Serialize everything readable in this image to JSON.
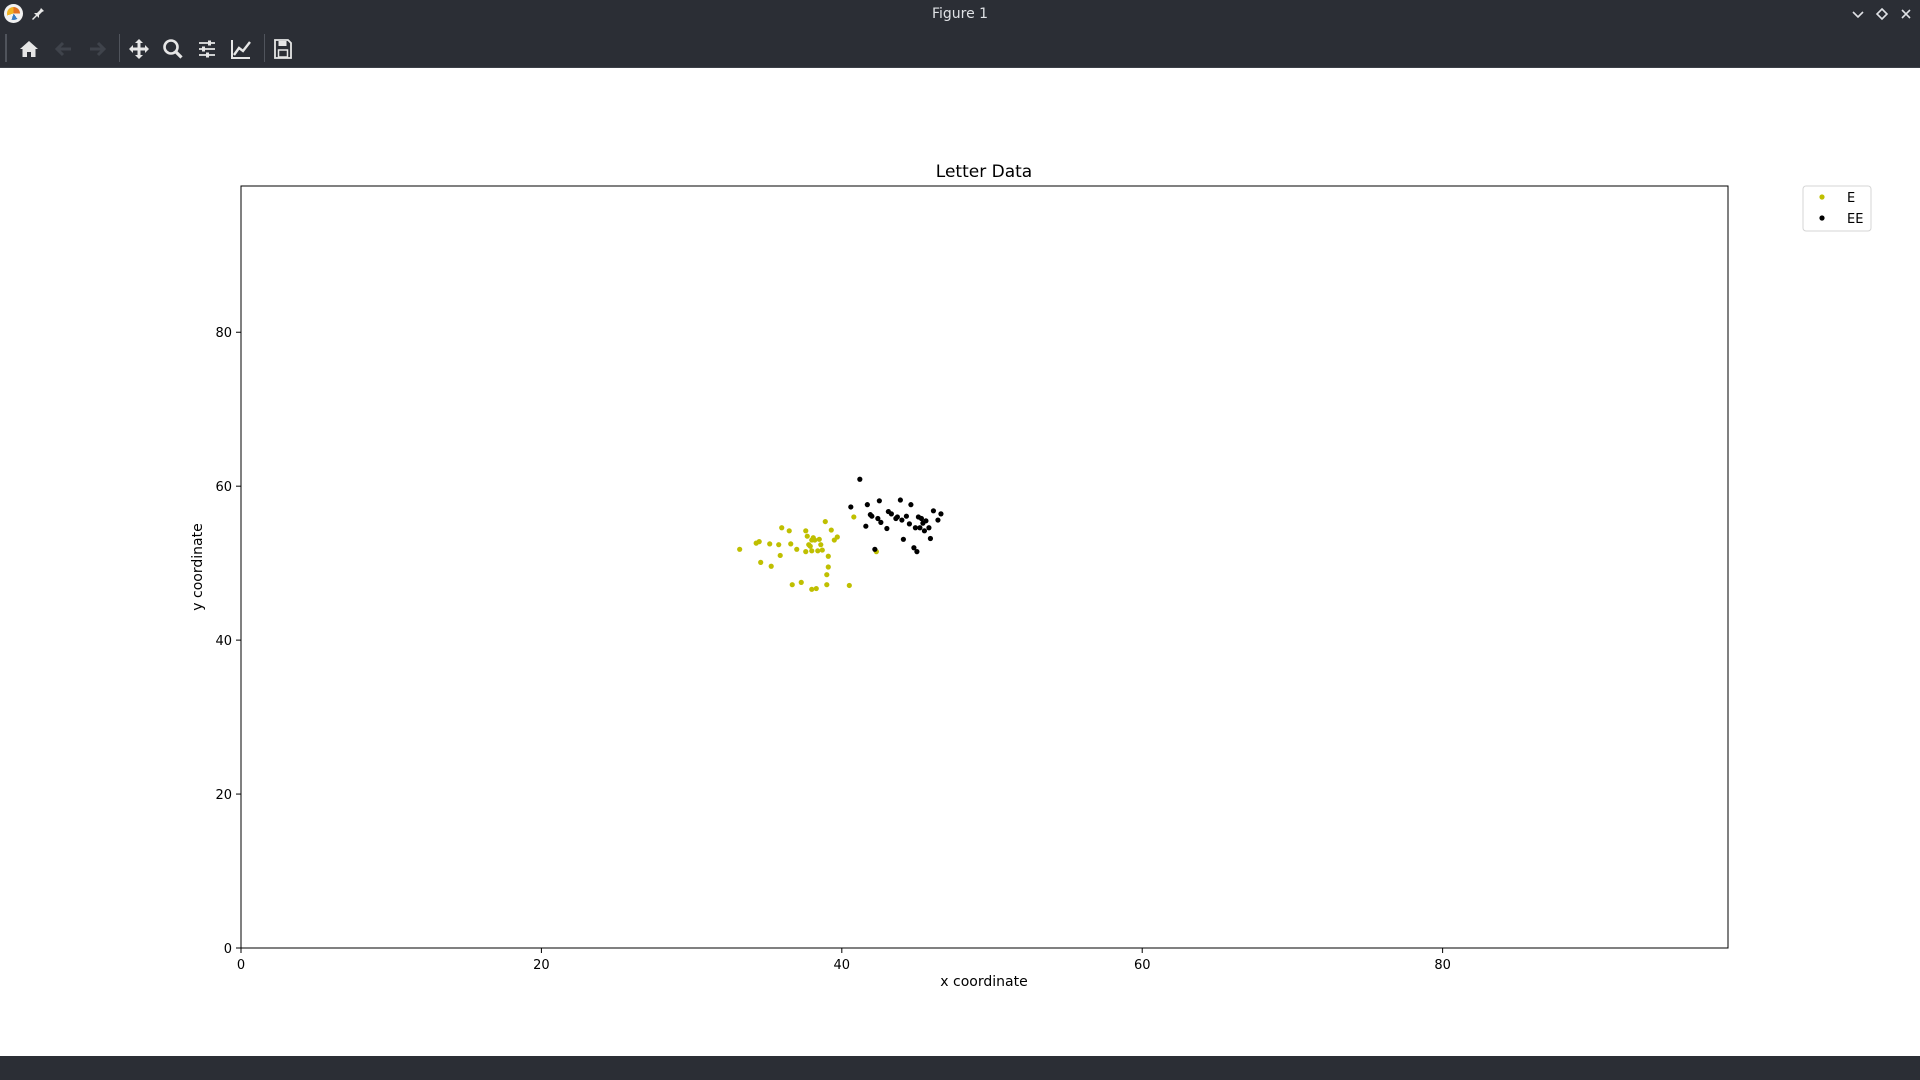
{
  "window": {
    "title": "Figure 1"
  },
  "toolbar": {
    "buttons": [
      {
        "name": "home",
        "icon": "home-icon",
        "enabled": true
      },
      {
        "name": "back",
        "icon": "arrow-left-icon",
        "enabled": false
      },
      {
        "name": "forward",
        "icon": "arrow-right-icon",
        "enabled": false
      },
      {
        "name": "pan",
        "icon": "move-icon",
        "enabled": true
      },
      {
        "name": "zoom",
        "icon": "magnifier-icon",
        "enabled": true
      },
      {
        "name": "subplots",
        "icon": "sliders-icon",
        "enabled": true
      },
      {
        "name": "customize",
        "icon": "chart-line-icon",
        "enabled": true
      },
      {
        "name": "save",
        "icon": "floppy-icon",
        "enabled": true
      }
    ]
  },
  "colors": {
    "chrome": "#2b2e35",
    "series_E": "#bfbf00",
    "series_EE": "#000000"
  },
  "chart_data": {
    "type": "scatter",
    "title": "Letter Data",
    "xlabel": "x coordinate",
    "ylabel": "y coordinate",
    "xlim": [
      0,
      99
    ],
    "ylim": [
      0,
      99
    ],
    "xticks": [
      0,
      20,
      40,
      60,
      80
    ],
    "yticks": [
      0,
      20,
      40,
      60,
      80
    ],
    "grid": false,
    "legend": "top-right-outside",
    "series": [
      {
        "name": "E",
        "color": "#bfbf00",
        "points": [
          [
            33.2,
            51.8
          ],
          [
            34.3,
            52.6
          ],
          [
            34.5,
            52.8
          ],
          [
            34.6,
            50.1
          ],
          [
            35.2,
            52.5
          ],
          [
            35.3,
            49.6
          ],
          [
            35.8,
            52.4
          ],
          [
            35.9,
            51.0
          ],
          [
            36.0,
            54.6
          ],
          [
            36.5,
            54.2
          ],
          [
            36.6,
            52.5
          ],
          [
            36.7,
            47.2
          ],
          [
            37.0,
            51.8
          ],
          [
            37.3,
            47.5
          ],
          [
            37.6,
            51.5
          ],
          [
            37.6,
            54.2
          ],
          [
            37.7,
            53.5
          ],
          [
            37.8,
            52.4
          ],
          [
            37.9,
            52.2
          ],
          [
            38.0,
            46.6
          ],
          [
            38.0,
            51.6
          ],
          [
            38.0,
            53.0
          ],
          [
            38.1,
            53.3
          ],
          [
            38.2,
            53.0
          ],
          [
            38.3,
            46.7
          ],
          [
            38.4,
            51.6
          ],
          [
            38.5,
            53.1
          ],
          [
            38.6,
            52.4
          ],
          [
            38.7,
            51.7
          ],
          [
            38.9,
            55.4
          ],
          [
            39.0,
            47.2
          ],
          [
            39.0,
            48.5
          ],
          [
            39.1,
            49.5
          ],
          [
            39.1,
            50.9
          ],
          [
            39.3,
            54.3
          ],
          [
            39.5,
            53.0
          ],
          [
            39.7,
            53.4
          ],
          [
            40.5,
            47.1
          ],
          [
            40.8,
            56.0
          ],
          [
            42.3,
            51.5
          ]
        ]
      },
      {
        "name": "EE",
        "color": "#000000",
        "points": [
          [
            40.6,
            57.3
          ],
          [
            41.2,
            60.9
          ],
          [
            41.6,
            54.8
          ],
          [
            41.7,
            57.6
          ],
          [
            41.9,
            56.3
          ],
          [
            42.0,
            56.1
          ],
          [
            42.2,
            51.8
          ],
          [
            42.4,
            55.8
          ],
          [
            42.5,
            58.1
          ],
          [
            42.6,
            55.3
          ],
          [
            43.0,
            54.5
          ],
          [
            43.1,
            56.7
          ],
          [
            43.3,
            56.4
          ],
          [
            43.6,
            55.8
          ],
          [
            43.7,
            56.0
          ],
          [
            43.9,
            58.2
          ],
          [
            44.0,
            55.6
          ],
          [
            44.1,
            53.1
          ],
          [
            44.3,
            56.1
          ],
          [
            44.5,
            55.1
          ],
          [
            44.6,
            57.6
          ],
          [
            44.8,
            52.0
          ],
          [
            44.9,
            54.6
          ],
          [
            45.0,
            51.5
          ],
          [
            45.1,
            56.0
          ],
          [
            45.2,
            54.6
          ],
          [
            45.3,
            55.8
          ],
          [
            45.4,
            55.2
          ],
          [
            45.5,
            54.2
          ],
          [
            45.6,
            55.5
          ],
          [
            45.8,
            54.6
          ],
          [
            45.9,
            53.2
          ],
          [
            46.1,
            56.8
          ],
          [
            46.4,
            55.6
          ],
          [
            46.6,
            56.4
          ]
        ]
      }
    ]
  }
}
